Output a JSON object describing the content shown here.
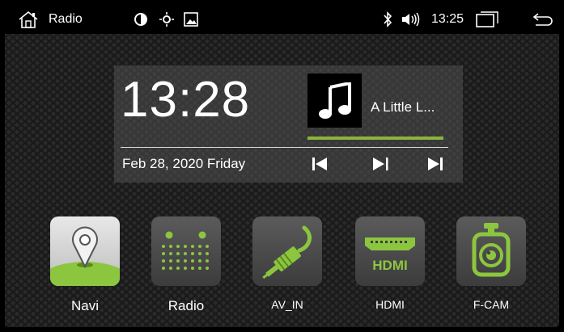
{
  "statusbar": {
    "title": "Radio",
    "time": "13:25",
    "icons": [
      "home-icon",
      "brightness-icon",
      "sun-icon",
      "image-icon",
      "bluetooth-icon",
      "volume-icon",
      "recent-apps-icon",
      "back-icon"
    ]
  },
  "widget": {
    "clock": "13:28",
    "date": "Feb 28, 2020 Friday",
    "song_title": "A Little L...",
    "progress_fraction": 1.0
  },
  "apps": [
    {
      "label": "Navi"
    },
    {
      "label": "Radio"
    },
    {
      "label": "AV_IN"
    },
    {
      "label": "HDMI"
    },
    {
      "label": "F-CAM"
    }
  ],
  "hdmi_logo_text": "HDMI",
  "colors": {
    "accent_green": "#8cb43c",
    "background": "#1a1a1a"
  }
}
